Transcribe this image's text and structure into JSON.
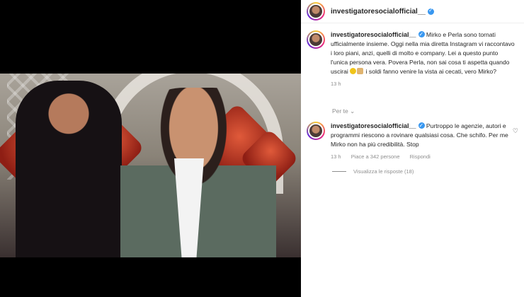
{
  "header": {
    "username": "investigatoresocialofficial__"
  },
  "caption": {
    "username": "investigatoresocialofficial__",
    "text_before": " Mirko e Perla sono tornati ufficialmente insieme. Oggi nella mia diretta Instagram vi raccontavo i loro piani, anzi, quelli di molto e company. Lei a questo punto l'unica persona vera. Povera Perla, non sai cosa ti aspetta quando uscirai ",
    "emoji_1": "face-emoji",
    "emoji_2": "money-emoji",
    "text_after": " i soldi fanno venire la vista ai cecati, vero Mirko?",
    "time": "13 h"
  },
  "filter_label": "Per te",
  "comment": {
    "username": "investigatoresocialofficial__",
    "text": " Purtroppo le agenzie, autori e programmi riescono a rovinare qualsiasi cosa. Che schifo. Per me Mirko non ha più credibilità. Stop",
    "time": "13 h",
    "likes": "Piace a 342 persone",
    "reply": "Rispondi"
  },
  "view_replies": "Visualizza le risposte (18)",
  "colors": {
    "verified": "#3897f0",
    "text": "#262626",
    "muted": "#8e8e8e"
  }
}
